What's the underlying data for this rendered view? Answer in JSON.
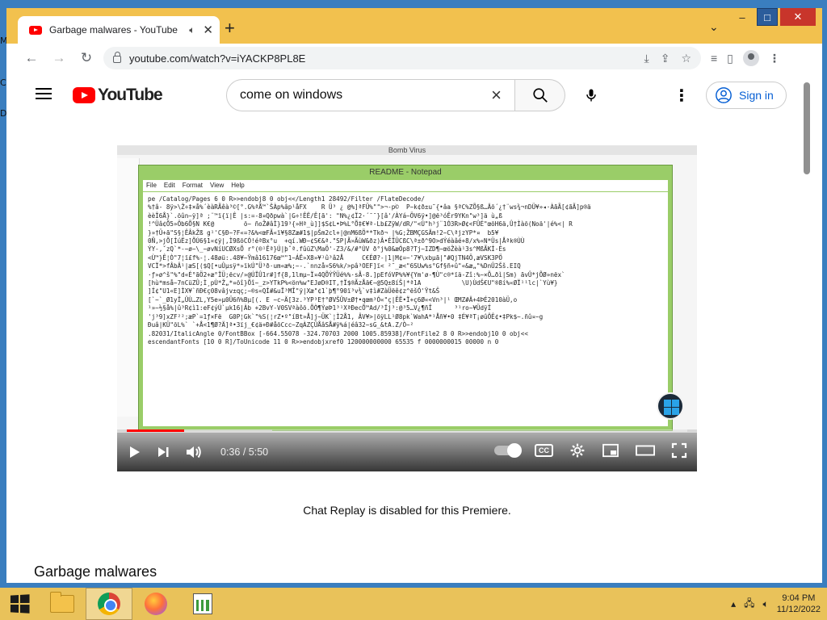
{
  "desktop": {
    "letters": [
      "M",
      "C",
      "D"
    ]
  },
  "tab": {
    "title": "Garbage malwares - YouTube",
    "audio_icon": "speaker-icon"
  },
  "window_controls": {
    "minimize": "–",
    "maximize": "□",
    "close": "✕"
  },
  "address_bar": {
    "url": "youtube.com/watch?v=iYACKP8PL8E"
  },
  "youtube": {
    "logo_text": "YouTube",
    "search_value": "come on windows",
    "sign_in": "Sign in"
  },
  "video": {
    "outer_title": "Bomb Virus",
    "notepad_title": "README - Notepad",
    "notepad_menu": [
      "File",
      "Edit",
      "Format",
      "View",
      "Help"
    ],
    "notepad_text": "pe /Catalog/Pages 6 0 R>>endobj8 0 obj<</Length1 28492/Filter /FlateDecode/\n%†â- 8ÿ>\\Ž÷‡×å%´èàRÃêà³©[°.G%ªÅ™`ŠÀp%âp¹åFX    R Ü³ ¿ @%]ªFÜ%\"\">¬-pׄ©  P~k¢ð±u˜{•âa §ªC%ZÕ§ß…Äõ´¿†¨ws¾¬nDÜ¥»◂·ÀãÃ[¢ãÃ]p®ä\nèèÎ6Å}`.õûn~ÿ]ª ;¨™ï{ï|Ê |s:=-8¤Qðpwà`|G÷!ÊË/Ê[ã': \"N%¿¢Ï2·´¯¯}[â'/ÀYá~ÖV6ÿ•]@ë³óÊr9YKn\"w³]ä ù„ß\n!^Üâ¢Õ5»Öb6Õ§N K€@        õ~ ñoŽ#âÌ}19³{»Hª_ù]]$S¢L•Þ%L°Õ‡€¥ª-Lb£ZÿW/dR/\"<Ú\"h³j¨1Ó3R>Ø¢<FÛÉ\"œõH6ä,Û†Ìàõ(Noä'|é%<| R\n}»†Ü+ã\"S§¦ÊÂkŽß g¹'C§Ð~?F«=?&%<œFÃ«ï¥§8Zæ#1$|pŠm2cl+|@nM6ßÖ**Tkð¬ |%G;ŽBMÇGSÄm!2~C\\ªjzYP*¤  b5¥\n0Ñ,>jÕ[ÍúËz]ÕÚ6§1«¢ÿ|,Ì9ßõCÓ!éªBx°u  +qí.WÐ~¢S€&ª.\"SP|Ã»ÃùW&ðz)Â•ÉÏÛCßC\\ª±ð^9O>dÝéàâé+8/x%«N*Üs|Åªk®ÙÙ\nÝY-,ˇzQ`*-~ø~\\_~øvNíUCØXsÕ r°(®¹Êª}Ú|þˆª.fûüZ\\MaÖ'-Z3/&/#°ÙV ð°j%0&æÓp8?Tj~IZD¶~œöŽèà¹3s^MßÃKÍ-És\n<Ù™}Ê¦Ò\"7¦ï£f%-¦.48øü:.48¥~Ÿmâ16176œ™\"1~ÁË»X8»¥¹û³â2Å     C€ÉØ?-|1|M¢=~'7¥\\xbµã|\"#QjTN4Ö,æVSK3PÖ\nVCÏ*>fÂbÂ¹|æS[($Q[•uÛµsÿ*»ïkÚ\"Ü³ð·um«æ%;~-.`nnzå»S6%k/>pâ³OEF]ï< ²¯_æ<\"6SUw%s°Gf§ñ+û\"«&æ„\"%DnÛ2Šš.EIQ\n·ƒ»ø^š\"%\"d«É°ãÖ2+æ°ÏÜ;ëcv/»@ÚÏÛ1r#]f{8,1lmµ~Ï¤4QÕÝŸÜé%%·sÃ-8.]pEfóVP%%¥{Ym'ø-¶Ù\"c®*ïä-Zî:%~×Õ…ðì|Sm) ãvÛ*jÕØ»nëx`\n[hù*mså~7nCüZÛ;Ì¸pÙ*Ž„*¤õî}Õî~_z>YTkP%<ön%w\"EJøD®IT,†Ï$®ÃzÅä€~@5Q±8íŠ|*ª1A           \\U)ÙdŠ€U\"®8í%«ØÏ¹¹lc|`Yù¥}\n]Í¢\"U1«E]ÌX¥`ñÐ€ç08vâjv±qç;~®s«QÍ#&uÏ³MÎ\"ÿ|Xæ\"¢1`þ¶°90ï³v¾`v‡ì#ZàÜëê¢z^ëšÓ'Ÿt&Š\n[`~`_Ø1yÏ„ÛÙ…ZL,Y5e»µ0Ü6ñ%Bµ[(. E ~c~Ä[3z.³YP³E†°ØVŠÛV±Ø†•qœm³Ó«\"ç|ÊË•Ï+ç6Ø«<Vn³|¹ ŒMZ#Ä+4ÞÉ2010àÜ,o\n¹»~½§å%|û³R¢ì1:eF¢ýÚ`µk16|Àb +2BvY-V0SVªàôõ.ÕÒ¶ÝøÞ1³¹XªÐecÕ™Ad/³Íj³:@³5…V¿¶ñÎ      ³¹ro~¥ÜdÿÍ\n'j³9]xZF²²;æP`=1ƒ×Fë  G0P¦Gk`\"%S(¦rZ•º\"íBt»Å]j~ÜK`¦Ì2Å1, ÂV¥>|öÿLL¹Ø8pk`WahA*¹Åñ¥•0 ‡É¥ªT¡øûÔÊ¢•‡Pk$~.ñû¤~g\nÐuâ|KÜ\"õL%` `+Å<1¶Ø?Ä]ª•3ïj_€¢ä+Ð#åõCcc~ZqÀZÇÜÅâSÅ#ÿ%á|éâ32~sG_&tA.Z/Ò~²\n.82031/ItalicAngle 0/FontBBox [-664.55078 -324.70703 2000 1005.85938]/FontFile2 8 0 R>>endobj10 0 obj<<\nescendantFonts [10 0 R]/ToUnicode 11 0 R>>endobjxref0 120000000000 65535 f 0000000015 00000 n 0",
    "progress": 0.102,
    "time_current": "0:36",
    "time_separator": " / ",
    "time_total": "5:50"
  },
  "chat_replay": "Chat Replay is disabled for this Premiere.",
  "video_title": "Garbage malwares",
  "taskbar": {
    "apps": [
      "file-explorer",
      "chrome",
      "firefox",
      "chart-app"
    ],
    "time": "9:04 PM",
    "date": "11/12/2022"
  },
  "colors": {
    "accent": "#ff0000",
    "link": "#065fd4",
    "taskbar": "#e9c25a",
    "window_frame": "#f2c14e"
  }
}
